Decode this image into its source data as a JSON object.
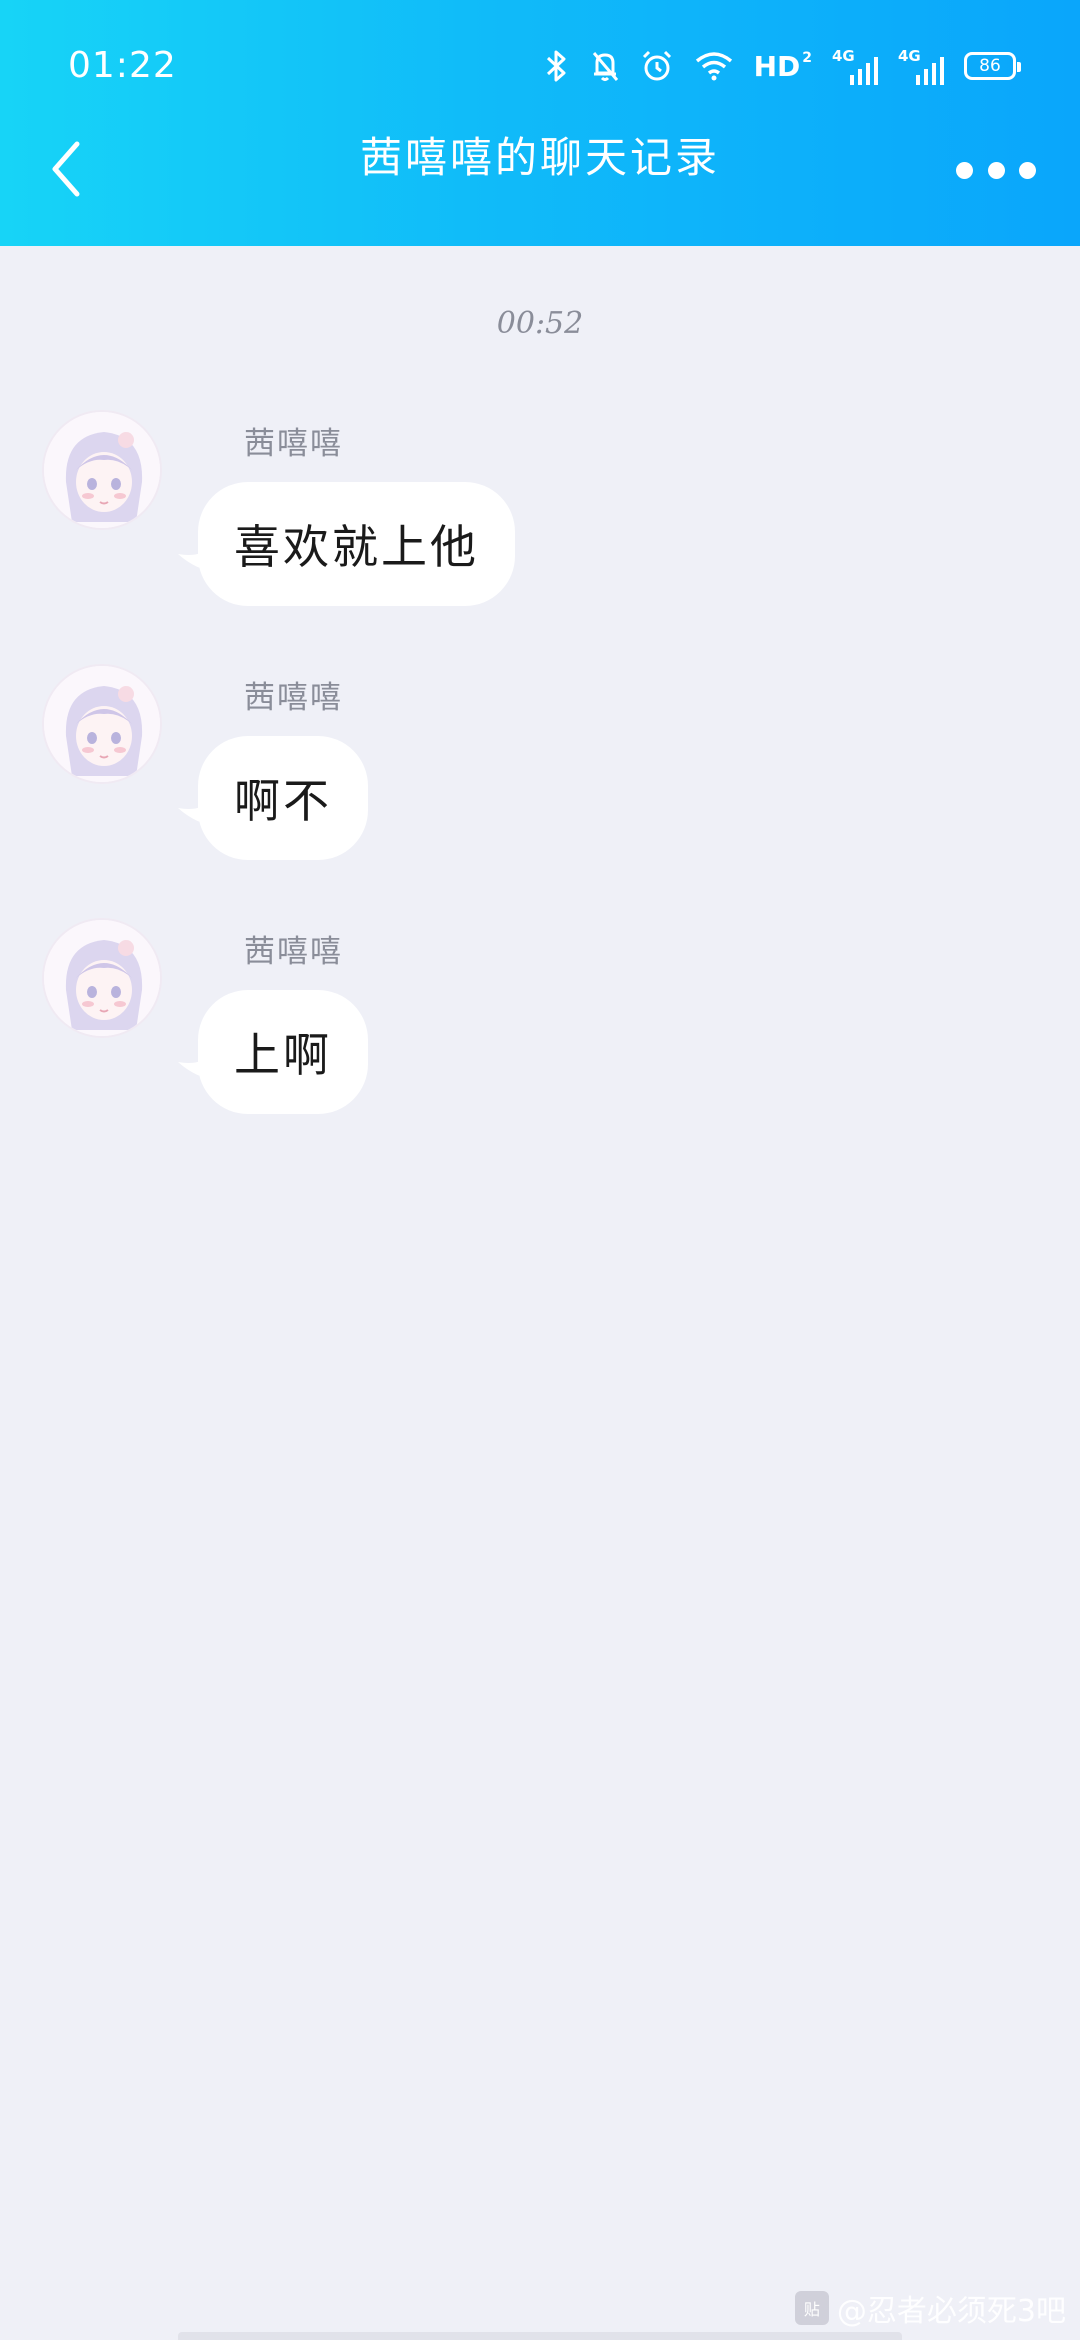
{
  "status_bar": {
    "time": "01:22",
    "hd_label": "HD",
    "hd_sub": "2",
    "network1": "4G",
    "network2": "4G",
    "battery": "86",
    "icons": [
      "bluetooth-icon",
      "mute-bell-icon",
      "alarm-icon",
      "wifi-icon",
      "hd-icon",
      "signal-icon",
      "signal-icon",
      "battery-icon"
    ]
  },
  "nav": {
    "title": "茜嘻嘻的聊天记录",
    "back_icon": "chevron-left-icon",
    "more_icon": "more-dots-icon"
  },
  "chat": {
    "timestamp": "00:52",
    "messages": [
      {
        "sender": "茜嘻嘻",
        "text": "喜欢就上他"
      },
      {
        "sender": "茜嘻嘻",
        "text": "啊不"
      },
      {
        "sender": "茜嘻嘻",
        "text": "上啊"
      }
    ]
  },
  "watermark": {
    "icon_text": "贴",
    "text": "@忍者必须死3吧"
  },
  "colors": {
    "header_start": "#17d4f7",
    "header_end": "#0aa6fb",
    "background": "#eff0f7",
    "bubble": "#ffffff",
    "meta_text": "#8a8d99"
  }
}
